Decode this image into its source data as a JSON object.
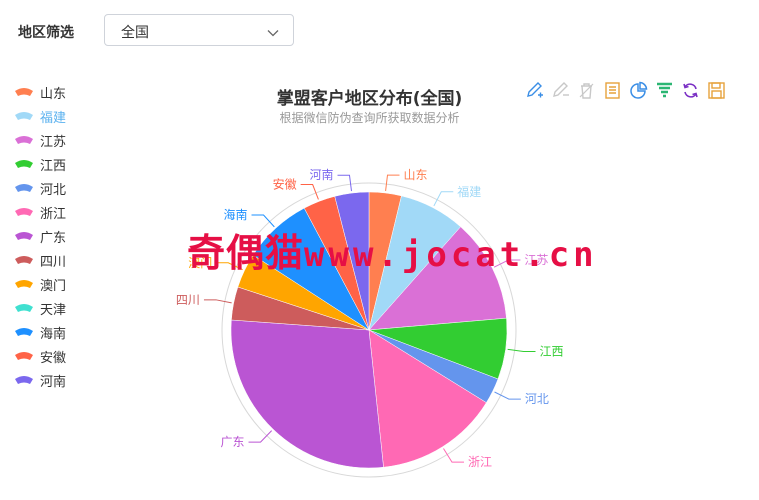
{
  "filter": {
    "label": "地区筛选",
    "selected": "全国"
  },
  "watermark": {
    "text_cn": "奇偶猫",
    "text_latin": "www.jocat.cn"
  },
  "toolbox": [
    {
      "name": "pen-icon",
      "color": "#3a8ee6"
    },
    {
      "name": "pen-disabled-icon",
      "color": "#c8c8c8"
    },
    {
      "name": "trash-disabled-icon",
      "color": "#c8c8c8"
    },
    {
      "name": "document-icon",
      "color": "#e6a23c"
    },
    {
      "name": "pie-chart-icon",
      "color": "#3a8ee6"
    },
    {
      "name": "funnel-icon",
      "color": "#2bb673"
    },
    {
      "name": "refresh-icon",
      "color": "#7a2fc4"
    },
    {
      "name": "save-icon",
      "color": "#e6a23c"
    }
  ],
  "chart_data": {
    "type": "pie",
    "title": "掌盟客户地区分布(全国)",
    "subtitle": "根据微信防伪查询所获取数据分析",
    "legend_position": "left",
    "slices": [
      {
        "name": "山东",
        "value": 3.6,
        "color": "#ff7f50",
        "shown": true
      },
      {
        "name": "福建",
        "value": 7.4,
        "color": "#a1d9f7",
        "shown": true
      },
      {
        "name": "江苏",
        "value": 11.5,
        "color": "#da70d6",
        "shown": true
      },
      {
        "name": "江西",
        "value": 6.8,
        "color": "#32cd32",
        "shown": true
      },
      {
        "name": "河北",
        "value": 2.9,
        "color": "#6495ed",
        "shown": true
      },
      {
        "name": "浙江",
        "value": 13.8,
        "color": "#ff69b4",
        "shown": true
      },
      {
        "name": "广东",
        "value": 26.5,
        "color": "#ba55d3",
        "shown": true
      },
      {
        "name": "四川",
        "value": 3.7,
        "color": "#cd5c5c",
        "shown": true
      },
      {
        "name": "澳门",
        "value": 3.9,
        "color": "#ffa500",
        "shown": true
      },
      {
        "name": "天津",
        "value": 2.8,
        "color": "#40e0d0",
        "shown": false
      },
      {
        "name": "海南",
        "value": 7.7,
        "color": "#1e90ff",
        "shown": true
      },
      {
        "name": "安徽",
        "value": 3.6,
        "color": "#ff6347",
        "shown": true
      },
      {
        "name": "河南",
        "value": 3.8,
        "color": "#7b68ee",
        "shown": true
      }
    ],
    "legend_muted": [
      "福建"
    ]
  }
}
